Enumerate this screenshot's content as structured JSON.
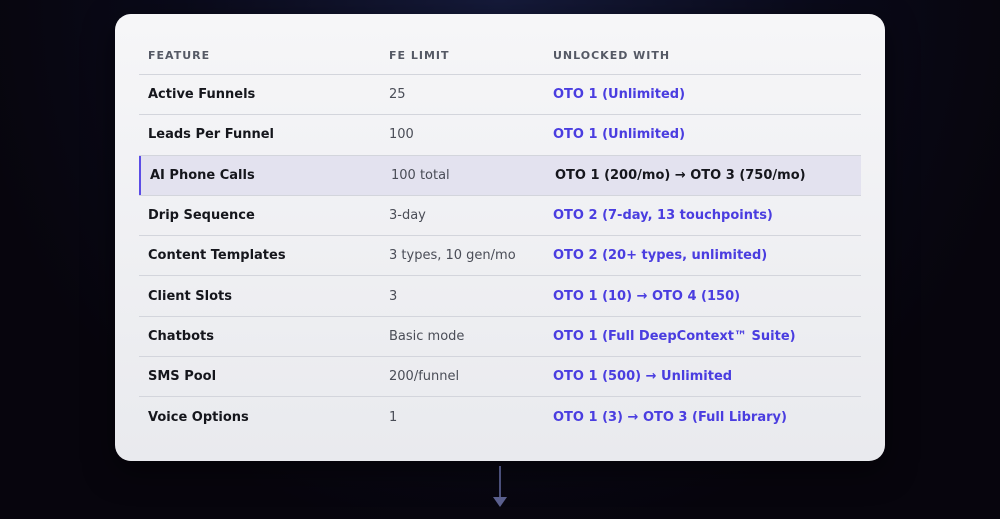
{
  "table": {
    "headers": {
      "feature": "FEATURE",
      "limit": "FE LIMIT",
      "unlock": "UNLOCKED WITH"
    },
    "rows": [
      {
        "feature": "Active Funnels",
        "limit": "25",
        "unlock": "OTO 1 (Unlimited)",
        "highlighted": false
      },
      {
        "feature": "Leads Per Funnel",
        "limit": "100",
        "unlock": "OTO 1 (Unlimited)",
        "highlighted": false
      },
      {
        "feature": "AI Phone Calls",
        "limit": "100 total",
        "unlock": "OTO 1 (200/mo) → OTO 3 (750/mo)",
        "highlighted": true
      },
      {
        "feature": "Drip Sequence",
        "limit": "3-day",
        "unlock": "OTO 2 (7-day, 13 touchpoints)",
        "highlighted": false
      },
      {
        "feature": "Content Templates",
        "limit": "3 types, 10 gen/mo",
        "unlock": "OTO 2 (20+ types, unlimited)",
        "highlighted": false
      },
      {
        "feature": "Client Slots",
        "limit": "3",
        "unlock": "OTO 1 (10) → OTO 4 (150)",
        "highlighted": false
      },
      {
        "feature": "Chatbots",
        "limit": "Basic mode",
        "unlock": "OTO 1 (Full DeepContext™ Suite)",
        "highlighted": false
      },
      {
        "feature": "SMS Pool",
        "limit": "200/funnel",
        "unlock": "OTO 1 (500) → Unlimited",
        "highlighted": false
      },
      {
        "feature": "Voice Options",
        "limit": "1",
        "unlock": "OTO 1 (3) → OTO 3 (Full Library)",
        "highlighted": false
      }
    ]
  },
  "colors": {
    "accent": "#4a3de0",
    "highlight_bg": "#e3e2ef",
    "highlight_bar": "#5b4de6"
  },
  "icons": {
    "connector": "arrow-down-icon"
  }
}
